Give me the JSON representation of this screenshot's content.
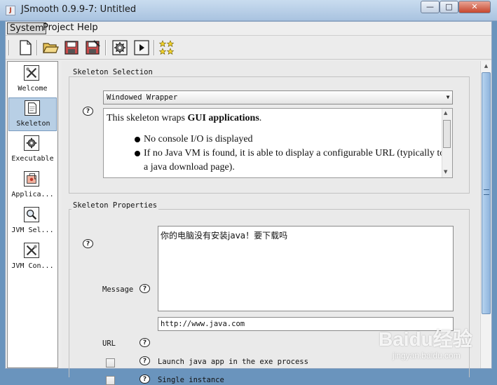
{
  "window": {
    "title": "JSmooth 0.9.9-7: Untitled",
    "app_icon_glyph": "J",
    "minimize_glyph": "—",
    "maximize_glyph": "□",
    "close_glyph": "✕"
  },
  "menu": {
    "system": "System",
    "project": "Project",
    "help": "Help"
  },
  "toolbar": {
    "buttons": [
      "new-file-icon",
      "open-folder-icon",
      "save-icon",
      "save-as-icon",
      "gear-compile-icon",
      "run-icon",
      "stars-icon"
    ]
  },
  "sidebar": {
    "items": [
      {
        "label": "Welcome",
        "icon": "tools-icon",
        "selected": false
      },
      {
        "label": "Skeleton",
        "icon": "document-icon",
        "selected": true
      },
      {
        "label": "Executable",
        "icon": "gear-icon",
        "selected": false
      },
      {
        "label": "Applica...",
        "icon": "application-icon",
        "selected": false
      },
      {
        "label": "JVM Sel...",
        "icon": "magnifier-icon",
        "selected": false
      },
      {
        "label": "JVM Con...",
        "icon": "tools-icon",
        "selected": false
      }
    ]
  },
  "skeleton_selection": {
    "title": "Skeleton Selection",
    "help_glyph": "?",
    "selected": "Windowed Wrapper",
    "dropdown_glyph": "▼",
    "description": {
      "intro_prefix": "This skeleton wraps ",
      "intro_bold": "GUI applications",
      "intro_suffix": ".",
      "bullet1": "No console I/O is displayed",
      "bullet2": "If no Java VM is found, it is able to display a configurable URL (typically to a java download page)."
    }
  },
  "skeleton_properties": {
    "title": "Skeleton Properties",
    "help_glyph": "?",
    "message_label": "Message",
    "message_value": "你的电脑没有安装java！要下载吗",
    "url_label": "URL",
    "url_value": "http://www.java.com",
    "launch_in_exe_label": "Launch java app in the exe process",
    "launch_in_exe_checked": false,
    "single_instance_label": "Single instance",
    "single_instance_checked": false
  },
  "watermark": {
    "logo": "Baidu经验",
    "url": "jingyan.baidu.com"
  },
  "colors": {
    "selection": "#b8cfe5",
    "titlebar": "#a9c3e0",
    "scroll_thumb": "#8fb5dd"
  }
}
